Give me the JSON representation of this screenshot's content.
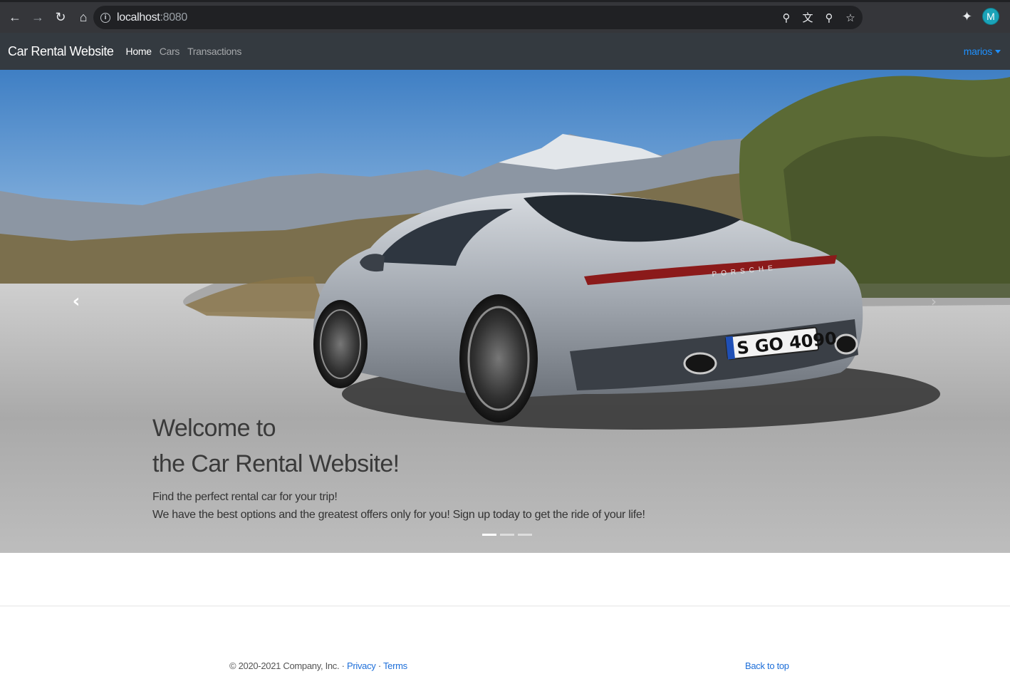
{
  "browser": {
    "url_host": "localhost",
    "url_port": ":8080",
    "profile_initial": "M",
    "icons": [
      "back-icon",
      "forward-icon",
      "reload-icon",
      "home-icon",
      "info-icon",
      "key-icon",
      "translate-icon",
      "zoom-icon",
      "star-icon",
      "extensions-icon"
    ]
  },
  "navbar": {
    "brand": "Car Rental Website",
    "links": [
      {
        "label": "Home",
        "active": true
      },
      {
        "label": "Cars",
        "active": false
      },
      {
        "label": "Transactions",
        "active": false
      }
    ],
    "user": "marios"
  },
  "carousel": {
    "title_line1": "Welcome to",
    "title_line2": "the Car Rental Website!",
    "text_line1": "Find the perfect rental car for your trip!",
    "text_line2": "We have the best options and the greatest offers only for you! Sign up today to get the ride of your life!",
    "slide_count": 3,
    "active_slide": 1,
    "plate": "S GO 4090",
    "badge": "PORSCHE"
  },
  "footer": {
    "copyright": "© 2020-2021 Company, Inc. · ",
    "privacy": "Privacy",
    "separator": " · ",
    "terms": "Terms",
    "back_to_top": "Back to top"
  },
  "colors": {
    "navbar_bg": "#343a40",
    "browser_bg": "#35363a",
    "link_blue": "#1e6fd9",
    "user_blue": "#1e90ff",
    "avatar": "#1aa3b8"
  }
}
